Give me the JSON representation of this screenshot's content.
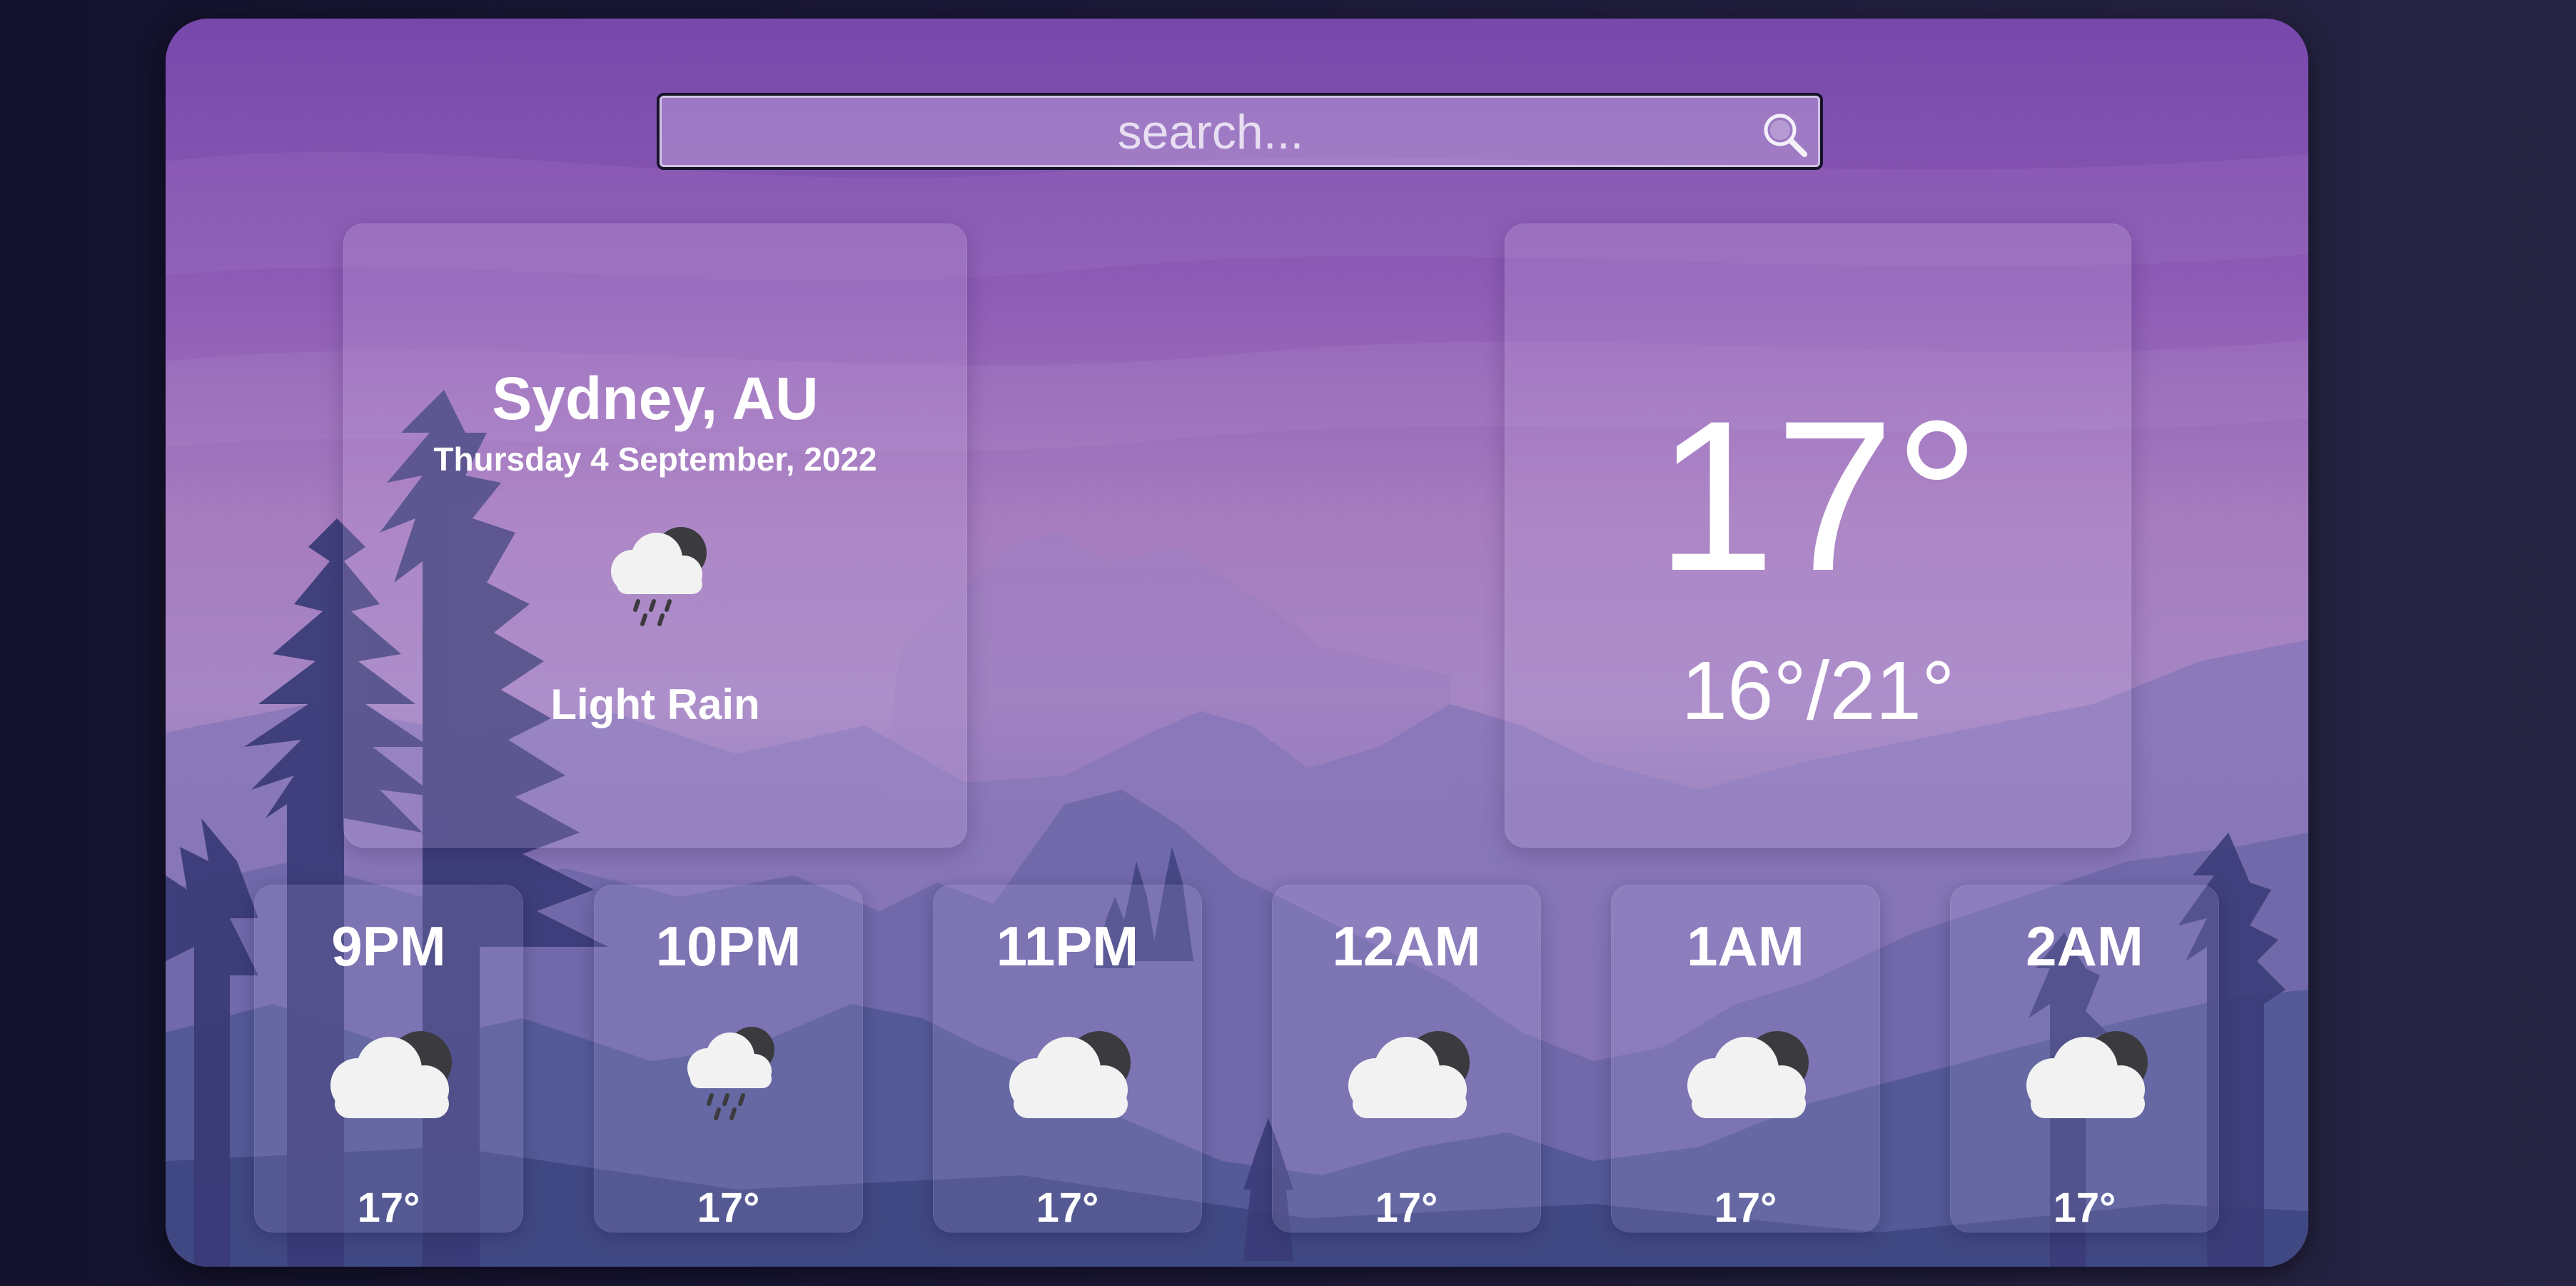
{
  "search": {
    "placeholder": "search..."
  },
  "current": {
    "city": "Sydney, AU",
    "date": "Thursday 4 September, 2022",
    "condition": "Light Rain",
    "icon": "cloud-rain-icon",
    "temperature": "17°",
    "range": "16°/21°"
  },
  "hourly": [
    {
      "time": "9PM",
      "temp": "17°",
      "icon": "cloud-icon"
    },
    {
      "time": "10PM",
      "temp": "17°",
      "icon": "cloud-rain-icon"
    },
    {
      "time": "11PM",
      "temp": "17°",
      "icon": "cloud-icon"
    },
    {
      "time": "12AM",
      "temp": "17°",
      "icon": "cloud-icon"
    },
    {
      "time": "1AM",
      "temp": "17°",
      "icon": "cloud-icon"
    },
    {
      "time": "2AM",
      "temp": "17°",
      "icon": "cloud-icon"
    }
  ],
  "colors": {
    "accent": "#7748ab",
    "background": "#14122c",
    "text": "#ffffff"
  }
}
